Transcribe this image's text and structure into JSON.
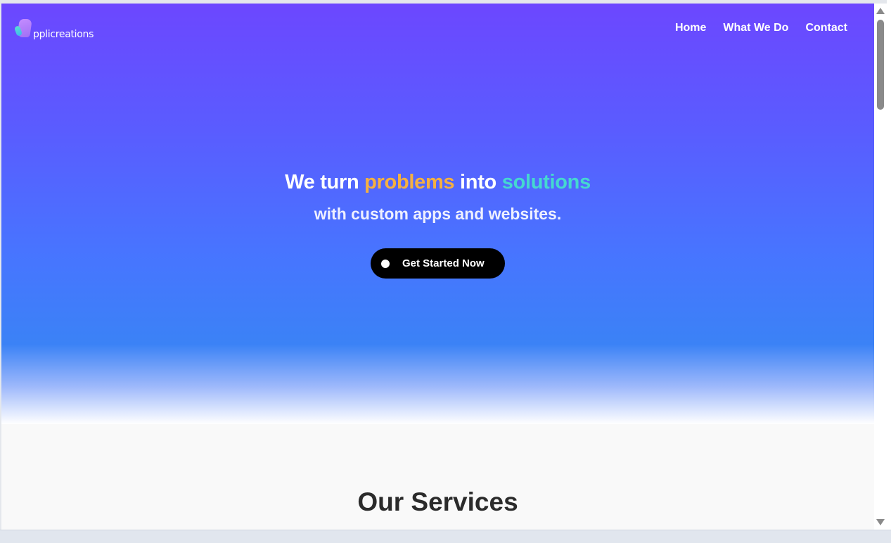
{
  "brand": {
    "logo_text": "pplicreations",
    "logo_icon": "applicreations-logo-icon"
  },
  "nav": {
    "items": [
      {
        "label": "Home"
      },
      {
        "label": "What We Do"
      },
      {
        "label": "Contact"
      }
    ]
  },
  "hero": {
    "headline_prefix": "We turn ",
    "headline_problems": "problems",
    "headline_middle": " into ",
    "headline_solutions": "solutions",
    "subline": "with custom apps and websites.",
    "cta_label": "Get Started Now",
    "cta_icon": "dot-icon"
  },
  "services": {
    "title": "Our Services"
  },
  "colors": {
    "gradient_top": "#6c47ff",
    "gradient_mid": "#3b82f6",
    "problems": "#f5b041",
    "solutions": "#45d8d0",
    "cta_bg": "#000000"
  }
}
